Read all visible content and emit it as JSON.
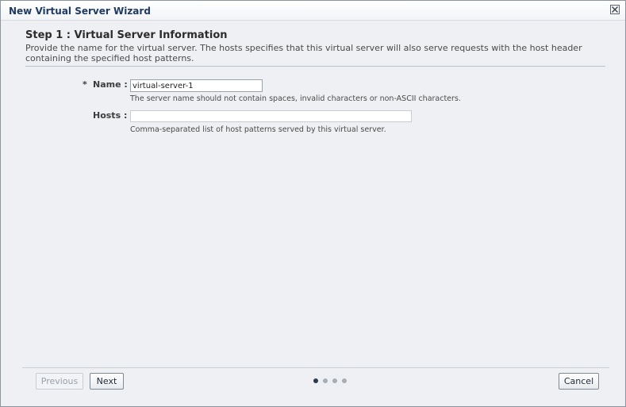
{
  "window": {
    "title": "New Virtual Server Wizard"
  },
  "step": {
    "title": "Step 1 : Virtual Server Information",
    "description": "Provide the name for the virtual server. The hosts specifies that this virtual server will also serve requests with the host header containing the specified host patterns."
  },
  "form": {
    "name": {
      "required_marker": "*",
      "label": "Name :",
      "value": "virtual-server-1",
      "hint": "The server name should not contain spaces, invalid characters or non-ASCII characters."
    },
    "hosts": {
      "label": "Hosts :",
      "value": "",
      "hint": "Comma-separated list of host patterns served by this virtual server."
    }
  },
  "footer": {
    "previous_label": "Previous",
    "next_label": "Next",
    "cancel_label": "Cancel",
    "train": {
      "total_steps": 4,
      "current_step": 1
    }
  },
  "icons": {
    "close": "close-icon"
  }
}
